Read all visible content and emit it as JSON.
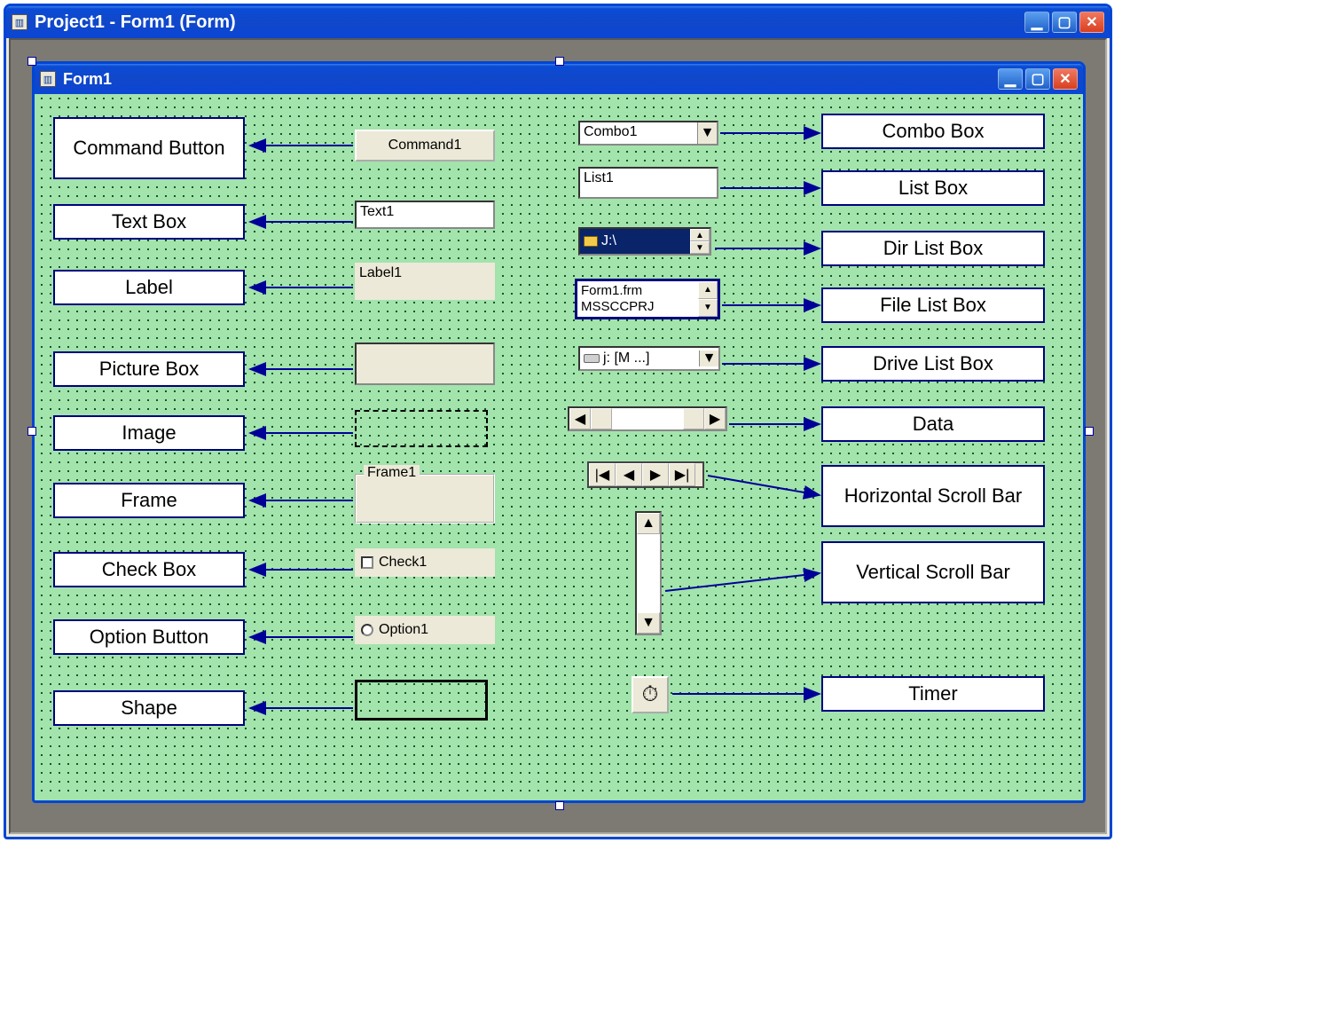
{
  "outerWindow": {
    "title": "Project1 - Form1 (Form)"
  },
  "innerWindow": {
    "title": "Form1"
  },
  "labels": {
    "commandButton": "Command Button",
    "textBox": "Text Box",
    "label": "Label",
    "pictureBox": "Picture Box",
    "image": "Image",
    "frame": "Frame",
    "checkBox": "Check Box",
    "optionButton": "Option Button",
    "shape": "Shape",
    "comboBox": "Combo Box",
    "listBox": "List Box",
    "dirListBox": "Dir List Box",
    "fileListBox": "File List Box",
    "driveListBox": "Drive List Box",
    "data": "Data",
    "horizontalScrollBar": "Horizontal Scroll Bar",
    "verticalScrollBar": "Vertical Scroll Bar",
    "timer": "Timer"
  },
  "controls": {
    "command": "Command1",
    "textbox": "Text1",
    "label": "Label1",
    "frame": "Frame1",
    "check": "Check1",
    "option": "Option1",
    "combo": "Combo1",
    "list": "List1",
    "dirList": "J:\\",
    "fileList": [
      "Form1.frm",
      "MSSCCPRJ"
    ],
    "driveList": "j: [M ...]"
  }
}
